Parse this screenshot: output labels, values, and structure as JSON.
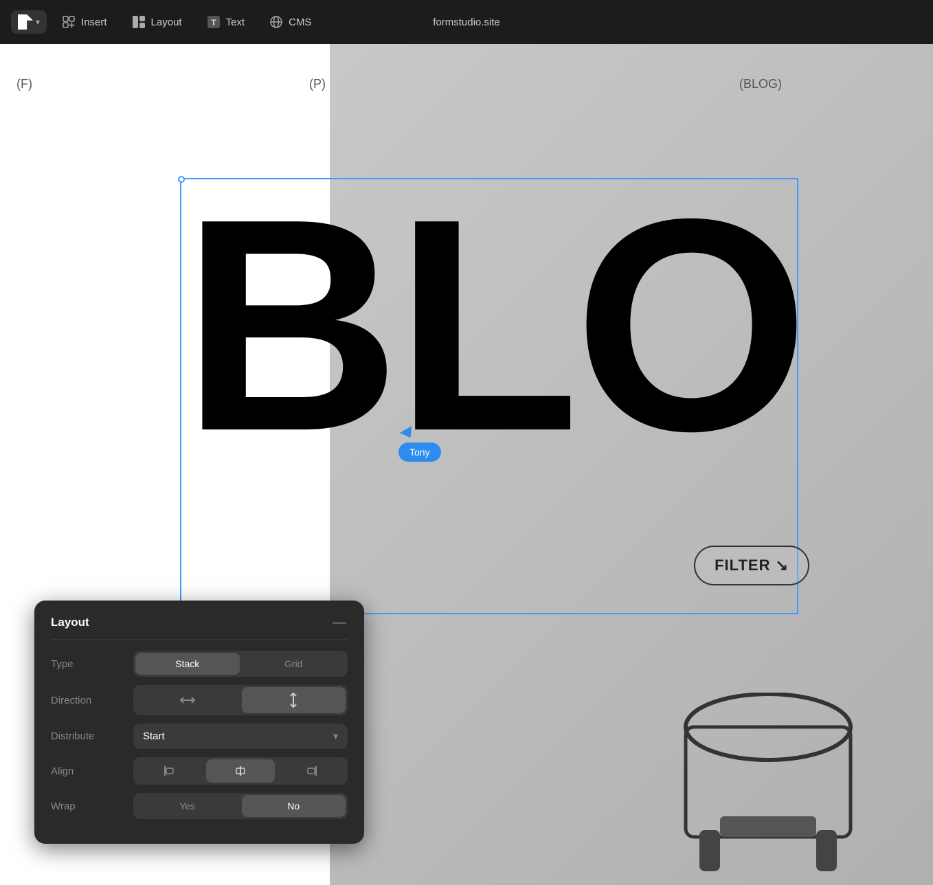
{
  "toolbar": {
    "logo_text": "F",
    "chevron": "▾",
    "insert_label": "Insert",
    "layout_label": "Layout",
    "text_label": "Text",
    "cms_label": "CMS",
    "site_title": "formstudio.site"
  },
  "canvas": {
    "guide_f": "(F)",
    "guide_p": "(P)",
    "guide_blog": "(BLOG)",
    "blo_text": "BLO",
    "cursor_user": "Tony",
    "filter_label": "FILTER ↘"
  },
  "layout_panel": {
    "title": "Layout",
    "collapse_icon": "—",
    "type_label": "Type",
    "type_stack": "Stack",
    "type_grid": "Grid",
    "direction_label": "Direction",
    "direction_horizontal": "↔",
    "direction_vertical": "↕",
    "distribute_label": "Distribute",
    "distribute_value": "Start",
    "distribute_arrow": "▾",
    "align_label": "Align",
    "align_left": "|←",
    "align_center": "⊕",
    "align_right": "→|",
    "wrap_label": "Wrap",
    "wrap_yes": "Yes",
    "wrap_no": "No"
  }
}
